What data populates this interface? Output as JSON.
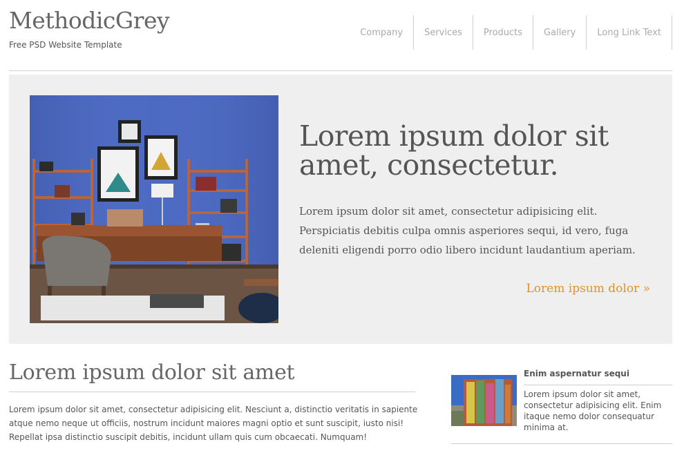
{
  "header": {
    "logo": "MethodicGrey",
    "tagline": "Free PSD Website Template",
    "nav": [
      {
        "label": "Company"
      },
      {
        "label": "Services"
      },
      {
        "label": "Products"
      },
      {
        "label": "Gallery"
      },
      {
        "label": "Long Link Text"
      }
    ]
  },
  "hero": {
    "title": "Lorem ipsum dolor sit amet, consectetur.",
    "text": "Lorem ipsum dolor sit amet, consectetur adipisicing elit. Perspiciatis debitis culpa omnis asperiores sequi, id vero, fuga deleniti eligendi porro odio libero incidunt laudantium aperiam.",
    "link": "Lorem ipsum dolor »",
    "accent_color": "#e0922a"
  },
  "main": {
    "title": "Lorem ipsum dolor sit amet",
    "text": "Lorem ipsum dolor sit amet, consectetur adipisicing elit. Nesciunt a, distinctio veritatis in sapiente atque nemo neque ut officiis, nostrum incidunt maiores magni optio et sunt suscipit, iusto nisi! Repellat ipsa distinctio suscipit debitis, incidunt ullam quis cum obcaecati. Numquam!"
  },
  "sidebar": {
    "item_title": "Enim aspernatur sequi",
    "item_text": "Lorem ipsum dolor sit amet, consectetur adipisicing elit. Enim itaque nemo dolor consequatur minima at."
  }
}
